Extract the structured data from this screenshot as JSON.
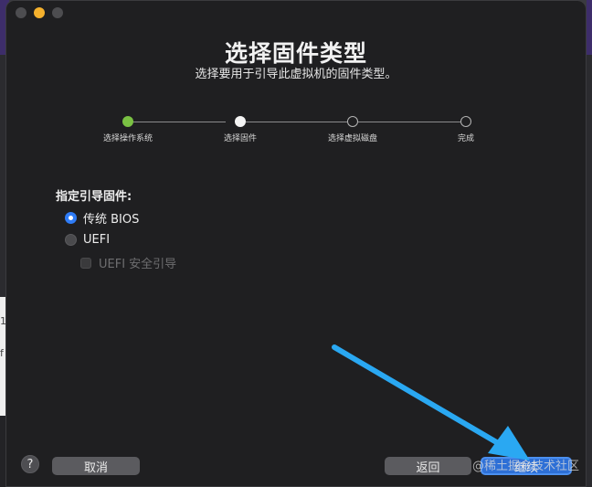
{
  "dialog": {
    "title": "选择固件类型",
    "subtitle": "选择要用于引导此虚拟机的固件类型。"
  },
  "steps": [
    {
      "label": "选择操作系统",
      "state": "done"
    },
    {
      "label": "选择固件",
      "state": "current"
    },
    {
      "label": "选择虚拟磁盘",
      "state": "todo"
    },
    {
      "label": "完成",
      "state": "todo"
    }
  ],
  "firmware": {
    "section_label": "指定引导固件:",
    "options": [
      {
        "label": "传统 BIOS",
        "selected": true
      },
      {
        "label": "UEFI",
        "selected": false
      }
    ],
    "secure_boot": {
      "label": "UEFI 安全引导",
      "checked": false,
      "enabled": false
    }
  },
  "footer": {
    "help": "?",
    "cancel": "取消",
    "back": "返回",
    "continue": "继续"
  },
  "watermark": "@稀土掘金技术社区",
  "colors": {
    "accent": "#2f7cf6",
    "step_done": "#7ac143",
    "annotation_arrow": "#2aa8f2",
    "window_bg": "#1f1f21"
  },
  "background": {
    "left_glyphs": [
      "1",
      "f"
    ]
  }
}
